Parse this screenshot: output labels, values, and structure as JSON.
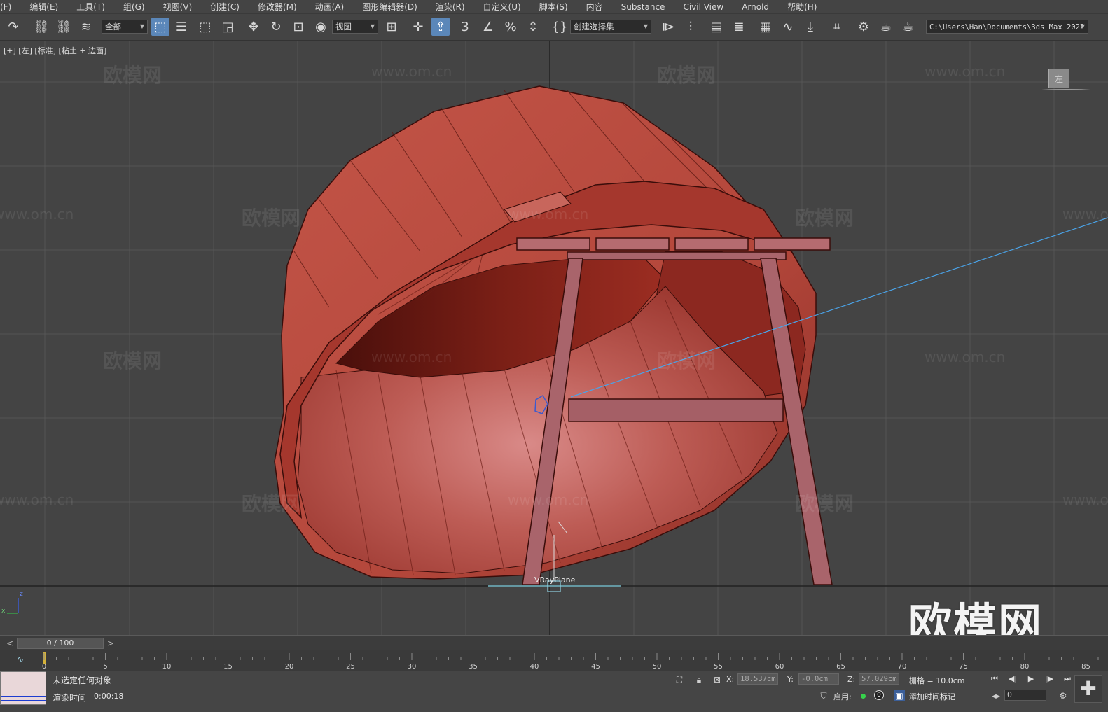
{
  "menubar": {
    "items": [
      "(F)",
      "编辑(E)",
      "工具(T)",
      "组(G)",
      "视图(V)",
      "创建(C)",
      "修改器(M)",
      "动画(A)",
      "图形编辑器(D)",
      "渲染(R)",
      "自定义(U)",
      "脚本(S)",
      "内容",
      "Substance",
      "Civil View",
      "Arnold",
      "帮助(H)"
    ]
  },
  "toolbar": {
    "selection_filter": "全部",
    "reference_coord": "视图",
    "named_selection": "创建选择集",
    "project_path": "C:\\Users\\Han\\Documents\\3ds Max 2022",
    "icons": [
      "redo-icon",
      "link-icon",
      "unlink-icon",
      "bind-spacewarp-icon",
      "select-object-icon",
      "select-by-name-icon",
      "rect-region-icon",
      "window-crossing-icon",
      "move-icon",
      "rotate-icon",
      "scale-icon",
      "placement-icon",
      "pivot-icon",
      "snaps-3d-icon",
      "angle-snap-icon",
      "percent-snap-icon",
      "spinner-snap-icon",
      "edit-named-sets-icon",
      "mirror-icon",
      "align-icon",
      "scene-explorer-icon",
      "layer-explorer-icon",
      "ribbon-icon",
      "curve-editor-icon",
      "dope-sheet-icon",
      "schematic-view-icon",
      "material-editor-icon",
      "render-setup-icon",
      "render-frame-icon",
      "render-production-icon"
    ]
  },
  "viewport": {
    "label": "[+] [左] [标准] [粘土 + 边面]",
    "viewcube_face": "左",
    "object_label": "VRayPlane",
    "watermark_cn": "欧模网",
    "watermark_url": "www.om.cn",
    "brand_logo": "欧模网",
    "axis_x": "x",
    "axis_z": "z"
  },
  "timeslider": {
    "frame_display": "0 / 100",
    "prev": "<",
    "next": ">"
  },
  "trackbar": {
    "ticks": [
      "0",
      "5",
      "10",
      "15",
      "20",
      "25",
      "30",
      "35",
      "40",
      "45",
      "50",
      "55",
      "60",
      "65",
      "70",
      "75",
      "80",
      "85"
    ]
  },
  "status": {
    "selection_message": "未选定任何对象",
    "render_time_label": "渲染时间",
    "render_time_value": "0:00:18",
    "x_label": "X:",
    "x_value": "18.537cm",
    "y_label": "Y:",
    "y_value": "-0.0cm",
    "z_label": "Z:",
    "z_value": "57.029cm",
    "grid_label": "栅格 = 10.0cm",
    "enable_label": "启用:",
    "key_toggle_value": "0",
    "add_time_tag": "添加时间标记",
    "current_frame": "0",
    "playback": [
      "⏮",
      "◀|",
      "▶",
      "|▶",
      "⏭"
    ]
  },
  "colors": {
    "viewport_bg": "#444444",
    "grid": "#555555",
    "model_red": "#b5473c",
    "model_edge": "#3a0d0a",
    "stool_pink": "#a9646b",
    "light_line": "#4aa3e8",
    "active_blue": "#5b87b9"
  }
}
